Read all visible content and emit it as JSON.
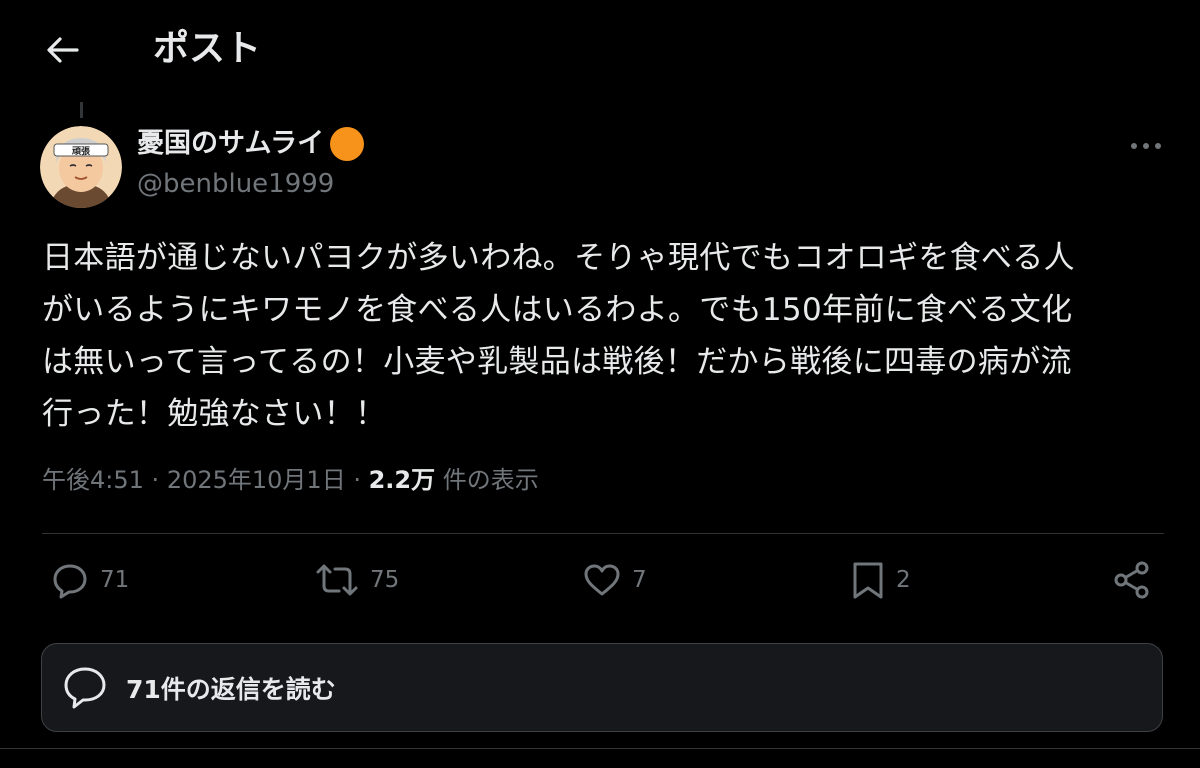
{
  "header": {
    "title": "ポスト"
  },
  "author": {
    "display_name": "憂国のサムライ",
    "handle": "@benblue1999",
    "badge_color": "#f7931a",
    "avatar_headband_text": "頑張"
  },
  "post": {
    "lines": [
      "日本語が通じないパヨクが多いわね。そりゃ現代でもコオロギを食べる人",
      "がいるようにキワモノを食べる人はいるわよ。でも150年前に食べる文化",
      "は無いって言ってるの！小麦や乳製品は戦後！だから戦後に四毒の病が流",
      "行った！勉強なさい！！"
    ],
    "time": "午後4:51",
    "date": "2025年10月1日",
    "views_count": "2.2万",
    "views_label": "件の表示"
  },
  "actions": {
    "replies": "71",
    "reposts": "75",
    "likes": "7",
    "bookmarks": "2"
  },
  "read_replies": {
    "label": "71件の返信を読む"
  },
  "colors": {
    "background": "#000000",
    "text": "#e7e9ea",
    "secondary": "#71767b",
    "border": "#2f3336"
  }
}
